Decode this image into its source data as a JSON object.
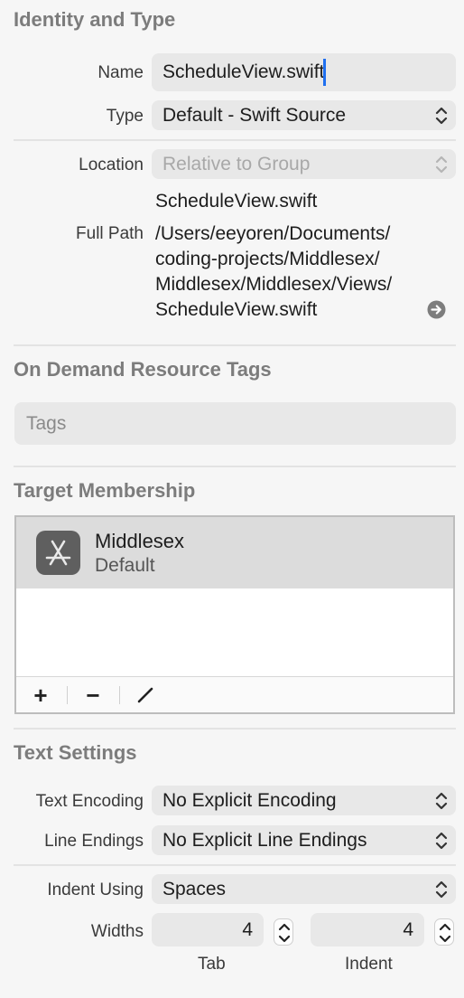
{
  "identity": {
    "title": "Identity and Type",
    "name_label": "Name",
    "name_value": "ScheduleView.swift",
    "type_label": "Type",
    "type_value": "Default - Swift Source",
    "location_label": "Location",
    "location_value": "Relative to Group",
    "filename": "ScheduleView.swift",
    "full_path_label": "Full Path",
    "full_path_lines": [
      "/Users/eeyoren/Documents/",
      "coding-projects/Middlesex/",
      "Middlesex/Middlesex/Views/",
      "ScheduleView.swift"
    ]
  },
  "on_demand": {
    "title": "On Demand Resource Tags",
    "tags_placeholder": "Tags"
  },
  "target_membership": {
    "title": "Target Membership",
    "targets": [
      {
        "name": "Middlesex",
        "subtitle": "Default",
        "icon": "app-store-icon"
      }
    ],
    "toolbar": {
      "add": "+",
      "remove": "−",
      "edit_icon": "pencil-icon"
    }
  },
  "text_settings": {
    "title": "Text Settings",
    "encoding_label": "Text Encoding",
    "encoding_value": "No Explicit Encoding",
    "line_endings_label": "Line Endings",
    "line_endings_value": "No Explicit Line Endings",
    "indent_label": "Indent Using",
    "indent_value": "Spaces",
    "widths_label": "Widths",
    "tab_width": "4",
    "tab_label": "Tab",
    "indent_width": "4",
    "indent_width_label": "Indent"
  },
  "colors": {
    "background": "#f6f6f6",
    "field": "#e8e8e8",
    "caret": "#1f6ff0",
    "section_title": "#7c7c7c"
  }
}
